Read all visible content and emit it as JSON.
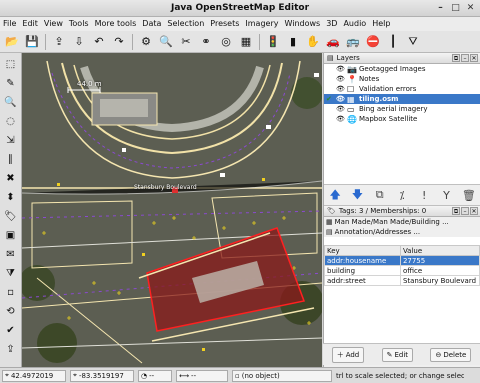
{
  "window": {
    "title": "Java OpenStreetMap Editor",
    "controls": [
      "–",
      "□",
      "✕"
    ]
  },
  "menu": [
    "File",
    "Edit",
    "View",
    "Tools",
    "More tools",
    "Data",
    "Selection",
    "Presets",
    "Imagery",
    "Windows",
    "3D",
    "Audio",
    "Help"
  ],
  "toolbar": [
    {
      "name": "open-file-icon",
      "glyph": "📂"
    },
    {
      "name": "save-icon",
      "glyph": "💾"
    },
    {
      "name": "upload-icon",
      "glyph": "⇪"
    },
    {
      "name": "download-icon",
      "glyph": "⇩"
    },
    {
      "name": "undo-icon",
      "glyph": "↶"
    },
    {
      "name": "redo-icon",
      "glyph": "↷"
    },
    {
      "name": "preferences-icon",
      "glyph": "⚙"
    },
    {
      "name": "search-icon",
      "glyph": "🔍"
    },
    {
      "name": "split-way-icon",
      "glyph": "✂"
    },
    {
      "name": "combine-icon",
      "glyph": "⚭"
    },
    {
      "name": "align-circle-icon",
      "glyph": "◎"
    },
    {
      "name": "map-paint-icon",
      "glyph": "▦"
    },
    {
      "name": "traffic-light-icon",
      "glyph": "🚦"
    },
    {
      "name": "barrier-icon",
      "glyph": "▮"
    },
    {
      "name": "hand-icon",
      "glyph": "✋"
    },
    {
      "name": "car-icon",
      "glyph": "🚗"
    },
    {
      "name": "bus-icon",
      "glyph": "🚌"
    },
    {
      "name": "dead-end-icon",
      "glyph": "⛔"
    },
    {
      "name": "bollard-icon",
      "glyph": "┃"
    },
    {
      "name": "stop-icon",
      "glyph": "⛛"
    }
  ],
  "lefttools": [
    "select-icon",
    "draw-icon",
    "zoom-icon",
    "lasso-icon",
    "improve-way-icon",
    "parallel-icon",
    "delete-icon",
    "extrude-icon",
    "tag-icon",
    "imagery-icon",
    "note-icon",
    "filter-icon",
    "minimap-icon",
    "history-icon",
    "validator-icon",
    "changeset-icon"
  ],
  "map": {
    "scale_label": "44.0 m",
    "street_label": "Stansbury Boulevard"
  },
  "layers": {
    "title": "Layers",
    "items": [
      {
        "label": "Geotagged Images",
        "icon": "📷",
        "checked": false,
        "selected": false
      },
      {
        "label": "Notes",
        "icon": "📍",
        "checked": false,
        "selected": false
      },
      {
        "label": "Validation errors",
        "icon": "☐",
        "checked": false,
        "selected": false
      },
      {
        "label": "tiling.osm",
        "icon": "▦",
        "checked": true,
        "selected": true
      },
      {
        "label": "Bing aerial imagery",
        "icon": "▭",
        "checked": false,
        "selected": false
      },
      {
        "label": "Mapbox Satellite",
        "icon": "🌐",
        "checked": false,
        "selected": false
      }
    ],
    "buttons": [
      "move-up-icon",
      "move-down-icon",
      "merge-icon",
      "visibility-icon",
      "activate-icon",
      "duplicate-icon",
      "delete-layer-icon"
    ],
    "button_glyphs": [
      "🡅",
      "🡇",
      "⧉",
      "⁒",
      "!",
      "Y",
      "🗑"
    ]
  },
  "tags": {
    "title": "Tags: 3 / Memberships: 0",
    "memberships": [
      "Man Made/Man Made/Building ...",
      "Annotation/Addresses ..."
    ],
    "col_key": "Key",
    "col_value": "Value",
    "rows": [
      {
        "key": "addr:housename",
        "value": "27755",
        "selected": true
      },
      {
        "key": "building",
        "value": "office",
        "selected": false
      },
      {
        "key": "addr:street",
        "value": "Stansbury Boulevard",
        "selected": false
      }
    ],
    "add_label": "Add",
    "edit_label": "Edit",
    "delete_label": "Delete"
  },
  "status": {
    "lat": "42.4972019",
    "lon": "-83.3519197",
    "heading": "--",
    "distance": "--",
    "object": "(no object)",
    "hint": "trl to scale selected; or change selection"
  },
  "colors": {
    "selection": "#3a78c8",
    "building_selected": "#e01010",
    "way_outline": "#f5e6b0"
  }
}
